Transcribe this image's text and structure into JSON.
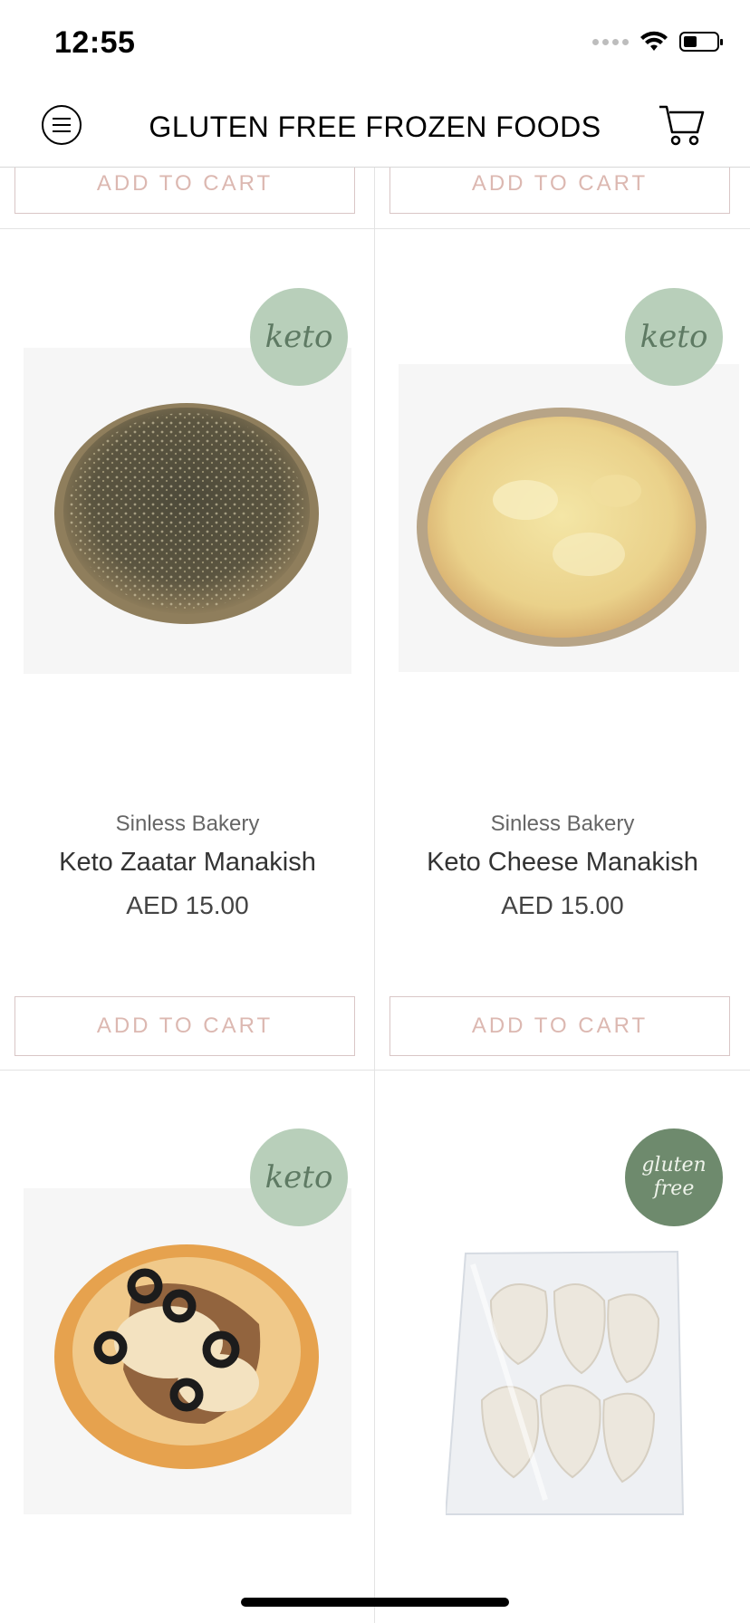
{
  "status_bar": {
    "time": "12:55",
    "battery_level_pct": 40
  },
  "header": {
    "title": "GLUTEN FREE FROZEN FOODS",
    "menu_icon": "hamburger-circle-icon",
    "cart_icon": "cart-icon"
  },
  "top_row": {
    "add_to_cart_left": "ADD TO CART",
    "add_to_cart_right": "ADD TO CART"
  },
  "products": [
    {
      "badge": "keto",
      "vendor": "Sinless Bakery",
      "name": "Keto Zaatar Manakish",
      "price": "AED 15.00",
      "button": "ADD TO CART"
    },
    {
      "badge": "keto",
      "vendor": "Sinless Bakery",
      "name": "Keto Cheese Manakish",
      "price": "AED 15.00",
      "button": "ADD TO CART"
    },
    {
      "badge": "keto"
    },
    {
      "badge_line1": "gluten",
      "badge_line2": "free"
    }
  ],
  "colors": {
    "keto_badge": "#b8cfba",
    "gluten_free_badge": "#6e8a6d",
    "button_text": "#dcb8b1"
  }
}
